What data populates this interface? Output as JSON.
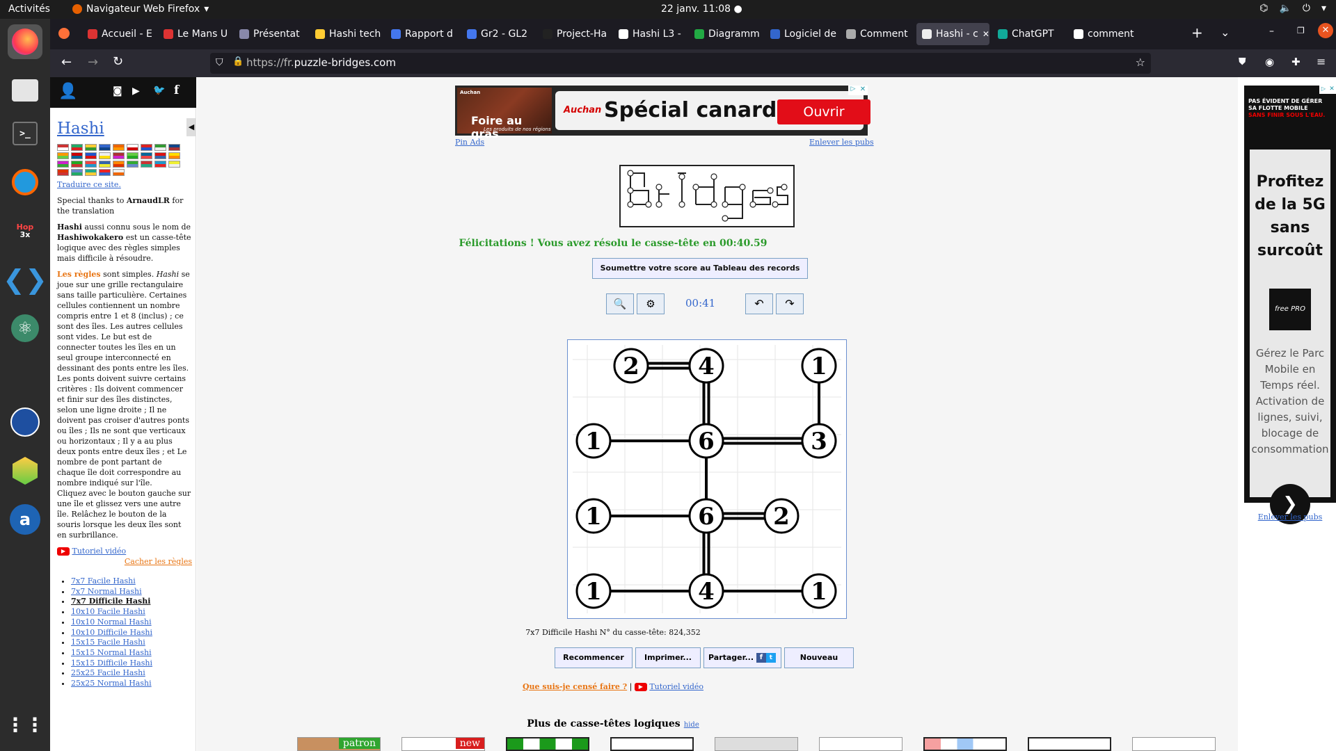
{
  "system": {
    "activities": "Activités",
    "app_menu": "Navigateur Web Firefox",
    "clock": "22 janv.  11:08"
  },
  "tabs": [
    {
      "label": "Accueil - E",
      "color": "#d33"
    },
    {
      "label": "Le Mans U",
      "color": "#d33"
    },
    {
      "label": "Présentat",
      "color": "#88a"
    },
    {
      "label": "Hashi tech",
      "color": "#fc3"
    },
    {
      "label": "Rapport d",
      "color": "#47e"
    },
    {
      "label": "Gr2 - GL2",
      "color": "#47e"
    },
    {
      "label": "Project-Ha",
      "color": "#222"
    },
    {
      "label": "Hashi L3 -",
      "color": "#fff"
    },
    {
      "label": "Diagramm",
      "color": "#2a4"
    },
    {
      "label": "Logiciel de",
      "color": "#36c"
    },
    {
      "label": "Comment",
      "color": "#aaa"
    },
    {
      "label": "Hashi - c",
      "color": "#eee"
    },
    {
      "label": "ChatGPT",
      "color": "#1a9"
    },
    {
      "label": "comment",
      "color": "#fff"
    }
  ],
  "active_tab_index": 11,
  "url": {
    "prefix": "https://fr.",
    "domain": "puzzle-bridges.com"
  },
  "sidebar": {
    "title": "Hashi",
    "translate": "Traduire ce site.",
    "thanks_pre": "Special thanks to ",
    "thanks_name": "ArnaudLR",
    "thanks_post": " for the translation",
    "p1_bold1": "Hashi",
    "p1_a": " aussi connu sous le nom de ",
    "p1_bold2": "Hashiwokakero",
    "p1_b": " est un casse-tête logique avec des règles simples mais difficile à résoudre.",
    "rules_head": "Les règles",
    "rules_a": " sont simples. ",
    "rules_it": "Hashi",
    "rules_b": " se joue sur une grille rectangulaire sans taille particulière. Certaines cellules contiennent un nombre compris entre 1 et 8 (inclus) ; ce sont des îles. Les autres cellules sont vides. Le but est de connecter toutes les îles en un seul groupe interconnecté en dessinant des ponts entre les îles. Les ponts doivent suivre certains critères : Ils doivent commencer et finir sur des îles distinctes, selon une ligne droite ; Il ne doivent pas croiser d'autres ponts ou îles ; Ils ne sont que verticaux ou horizontaux ; Il y a au plus deux ponts entre deux îles ; et Le nombre de pont partant de chaque île doit correspondre au nombre indiqué sur l'île.",
    "rules_c": "Cliquez avec le bouton gauche sur une île et glissez vers une autre île. Relâchez le bouton de la souris lorsque les deux îles sont en surbrillance.",
    "video": "Tutoriel vidéo",
    "hide_rules": "Cacher les règles",
    "levels": [
      "7x7 Facile Hashi",
      "7x7 Normal Hashi",
      "7x7 Difficile Hashi",
      "10x10 Facile Hashi",
      "10x10 Normal Hashi",
      "10x10 Difficile Hashi",
      "15x15 Facile Hashi",
      "15x15 Normal Hashi",
      "15x15 Difficile Hashi",
      "25x25 Facile Hashi",
      "25x25 Normal Hashi"
    ],
    "current_level": 2
  },
  "ad_top": {
    "brand": "Auchan",
    "left_text": "Foire au gras",
    "left_sub": "Les produits de nos régions",
    "headline": "Spécial canard",
    "button": "Ouvrir",
    "pin": "Pin Ads",
    "remove": "Enlever les pubs"
  },
  "ad_right": {
    "top_line1": "PAS ÉVIDENT DE GÉRER",
    "top_line2": "SA FLOTTE MOBILE",
    "top_line3": "SANS FINIR SOUS L'EAU.",
    "headline": "Profitez de la 5G sans surcoût",
    "logo": "free PRO",
    "body": "Gérez le Parc Mobile en Temps réel. Activation de lignes, suivi, blocage de consommation",
    "remove": "Enlever les pubs"
  },
  "game": {
    "congrats": "Félicitations ! Vous avez résolu le casse-tête en 00:40.59",
    "submit": "Soumettre votre score au Tableau des records",
    "timer": "00:41",
    "puzzle_info": "7x7 Difficile Hashi N° du casse-tête: 824,352",
    "buttons": {
      "restart": "Recommencer",
      "print": "Imprimer...",
      "share": "Partager...",
      "new": "Nouveau"
    },
    "what_todo": "Que suis-je censé faire ?",
    "video": "Tutoriel vidéo",
    "more": "Plus de casse-têtes logiques",
    "hide": "hide",
    "thumb_badges": [
      "patron",
      "new"
    ]
  },
  "puzzle": {
    "cols": 7,
    "rows": 7,
    "islands": [
      {
        "r": 0,
        "c": 1,
        "n": "2"
      },
      {
        "r": 0,
        "c": 2,
        "n": "4"
      },
      {
        "r": 0,
        "c": 4,
        "n": "1"
      },
      {
        "r": 1,
        "c": 0,
        "n": "1"
      },
      {
        "r": 1,
        "c": 2,
        "n": "6"
      },
      {
        "r": 1,
        "c": 4,
        "n": "3"
      },
      {
        "r": 2,
        "c": 0,
        "n": "1"
      },
      {
        "r": 2,
        "c": 2,
        "n": "6"
      },
      {
        "r": 2,
        "c": 3,
        "n": "2"
      },
      {
        "r": 3,
        "c": 0,
        "n": "1"
      },
      {
        "r": 3,
        "c": 2,
        "n": "4"
      },
      {
        "r": 3,
        "c": 4,
        "n": "1"
      }
    ],
    "bridges": [
      {
        "a": 0,
        "b": 1,
        "count": 2
      },
      {
        "a": 1,
        "b": 4,
        "count": 2
      },
      {
        "a": 2,
        "b": 5,
        "count": 1
      },
      {
        "a": 3,
        "b": 4,
        "count": 1
      },
      {
        "a": 4,
        "b": 5,
        "count": 2
      },
      {
        "a": 4,
        "b": 7,
        "count": 1
      },
      {
        "a": 6,
        "b": 7,
        "count": 1
      },
      {
        "a": 7,
        "b": 8,
        "count": 2
      },
      {
        "a": 7,
        "b": 10,
        "count": 2
      },
      {
        "a": 9,
        "b": 10,
        "count": 1
      },
      {
        "a": 10,
        "b": 11,
        "count": 1
      }
    ]
  }
}
